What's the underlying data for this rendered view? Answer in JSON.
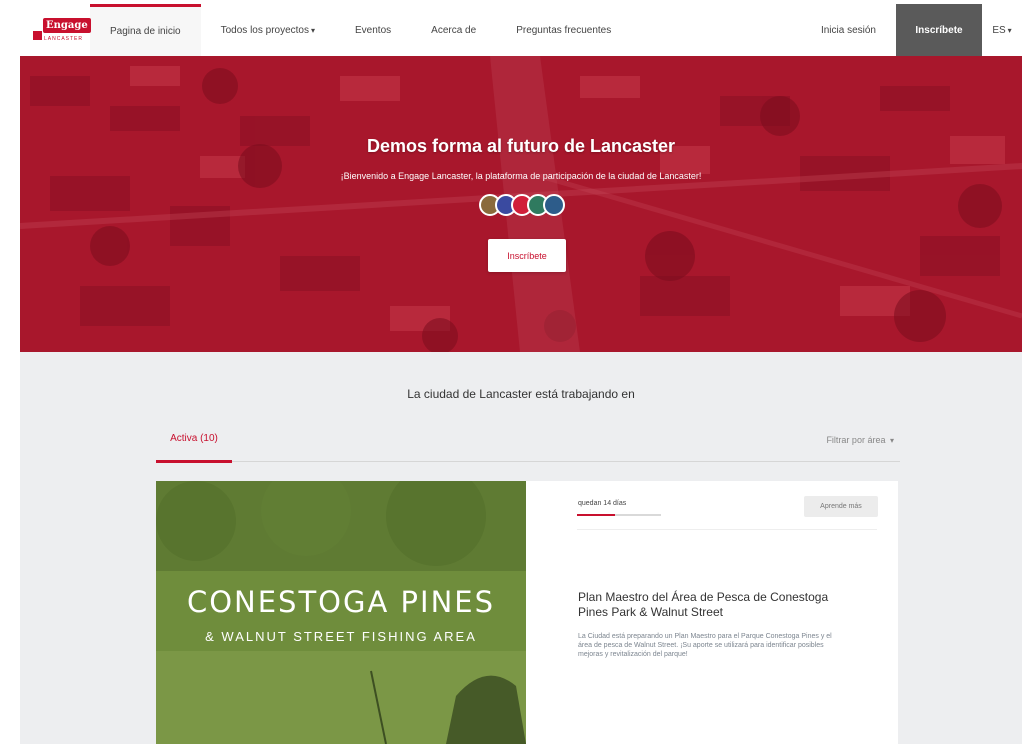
{
  "brand": {
    "logo_text": "Engage",
    "logo_subtext": "LANCASTER",
    "color": "#c8102e"
  },
  "nav": {
    "items": [
      {
        "label": "Pagina de inicio",
        "active": true
      },
      {
        "label": "Todos los proyectos",
        "dropdown": true
      },
      {
        "label": "Eventos"
      },
      {
        "label": "Acerca de"
      },
      {
        "label": "Preguntas frecuentes"
      }
    ],
    "login": "Inicia sesión",
    "signup": "Inscríbete",
    "language": "ES"
  },
  "hero": {
    "title": "Demos forma al futuro de Lancaster",
    "subtitle": "¡Bienvenido a Engage Lancaster, la plataforma de participación de la ciudad de Lancaster!",
    "button": "Inscríbete",
    "overlay_color": "#b01530"
  },
  "main": {
    "heading": "La ciudad de Lancaster está trabajando en",
    "tabs": [
      {
        "label": "Activa (10)",
        "active": true
      }
    ],
    "filter_label": "Filtrar por área"
  },
  "project": {
    "image_title": "CONESTOGA PINES",
    "image_subtitle": "& WALNUT STREET FISHING AREA",
    "days_left": "quedan 14 días",
    "progress": 0.45,
    "learn_more": "Aprende más",
    "title": "Plan Maestro del Área de Pesca de Conestoga Pines Park & Walnut Street",
    "description": "La Ciudad está preparando un Plan Maestro para el Parque Conestoga Pines y el área de pesca de Walnut Street. ¡Su aporte se utilizará para identificar posibles mejoras y revitalización del parque!"
  },
  "icons": {
    "dropdown": "chevron-down-icon",
    "lang_dropdown": "chevron-down-icon"
  }
}
